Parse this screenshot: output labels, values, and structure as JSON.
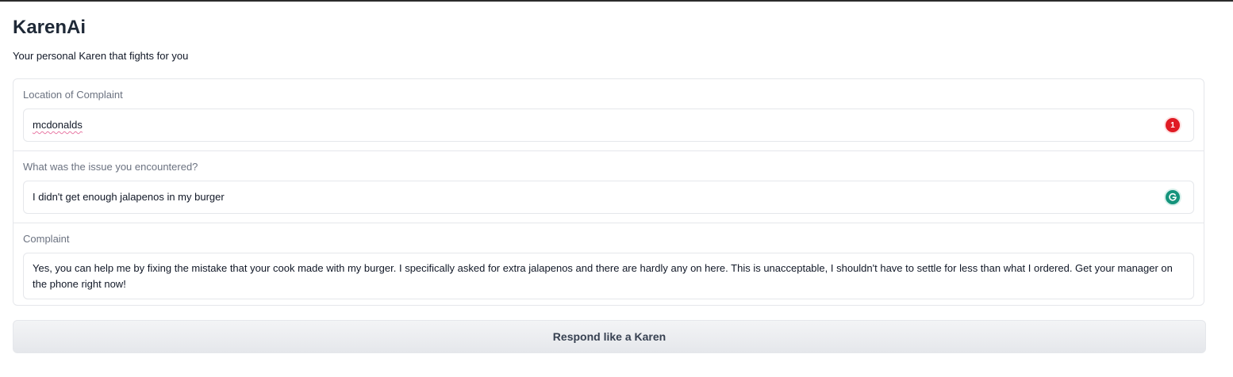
{
  "app": {
    "title": "KarenAi",
    "subtitle": "Your personal Karen that fights for you"
  },
  "fields": {
    "location": {
      "label": "Location of Complaint",
      "value": "mcdonalds",
      "error_count": "1"
    },
    "issue": {
      "label": "What was the issue you encountered?",
      "value": "I didn't get enough jalapenos in my burger"
    },
    "complaint": {
      "label": "Complaint",
      "value": "Yes, you can help me by fixing the mistake that your cook made with my burger. I specifically asked for extra jalapenos and there are hardly any on here. This is unacceptable, I shouldn't have to settle for less than what I ordered. Get your manager on the phone right now!"
    }
  },
  "actions": {
    "respond_label": "Respond like a Karen"
  },
  "icons": {
    "error_badge": "error-count-icon",
    "grammar_badge": "grammarly-icon"
  },
  "colors": {
    "error_badge": "#e01b24",
    "grammar_badge": "#15947c",
    "spell_underline": "#e879a4"
  }
}
